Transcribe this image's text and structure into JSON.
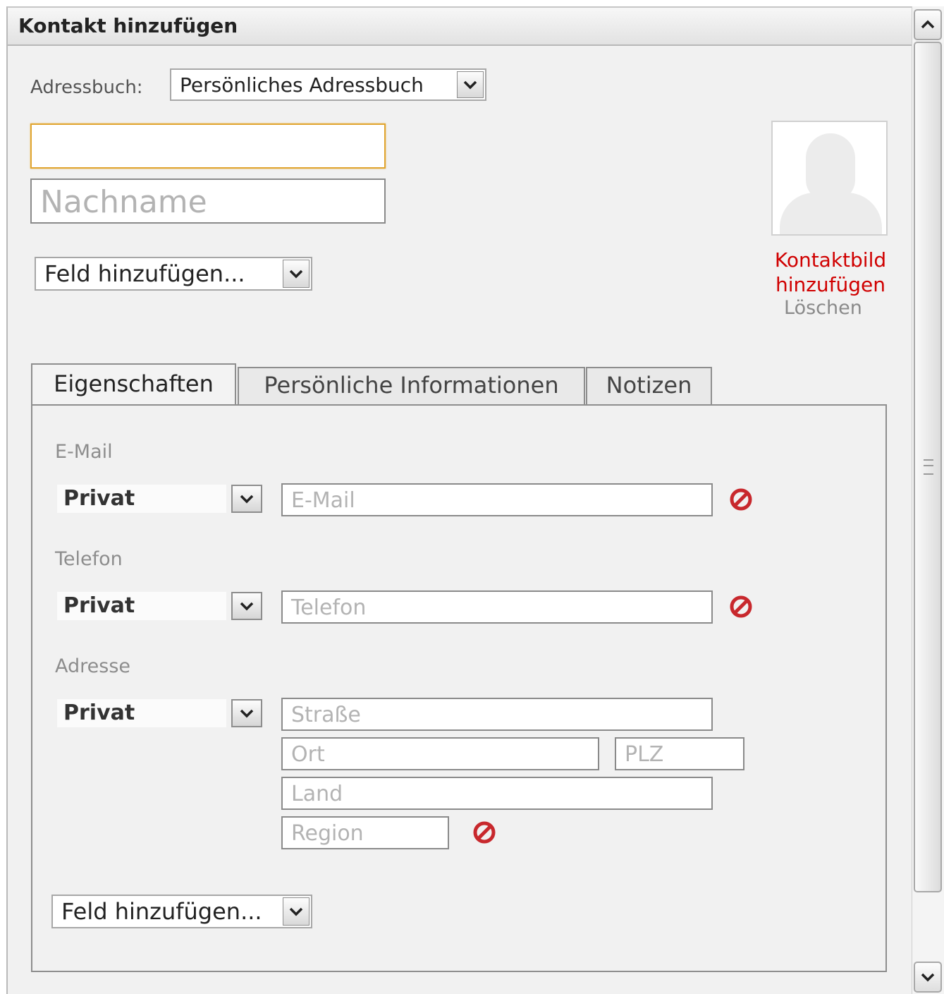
{
  "window": {
    "title": "Kontakt hinzufügen"
  },
  "addressbook": {
    "label": "Adressbuch:",
    "selected": "Persönliches Adressbuch"
  },
  "name": {
    "first_value": "",
    "first_placeholder": "",
    "last_placeholder": "Nachname"
  },
  "add_field_top": {
    "selected": "Feld hinzufügen..."
  },
  "photo": {
    "add_label_line1": "Kontaktbild",
    "add_label_line2": "hinzufügen",
    "delete_label": "Löschen"
  },
  "tabs": [
    {
      "label": "Eigenschaften",
      "active": true
    },
    {
      "label": "Persönliche Informationen",
      "active": false
    },
    {
      "label": "Notizen",
      "active": false
    }
  ],
  "email": {
    "section_label": "E-Mail",
    "type": "Privat",
    "placeholder": "E-Mail"
  },
  "phone": {
    "section_label": "Telefon",
    "type": "Privat",
    "placeholder": "Telefon"
  },
  "address": {
    "section_label": "Adresse",
    "type": "Privat",
    "street_placeholder": "Straße",
    "city_placeholder": "Ort",
    "zip_placeholder": "PLZ",
    "country_placeholder": "Land",
    "region_placeholder": "Region"
  },
  "add_field_bottom": {
    "selected": "Feld hinzufügen..."
  },
  "icons": {
    "delete": "delete-icon",
    "dropdown": "chevron-down-icon",
    "scroll_up": "chevron-up-icon",
    "scroll_down": "chevron-down-icon",
    "avatar": "person-silhouette-icon"
  },
  "colors": {
    "link_red": "#d00000",
    "delete_red": "#c8282d",
    "focus_border": "#e0a531"
  }
}
